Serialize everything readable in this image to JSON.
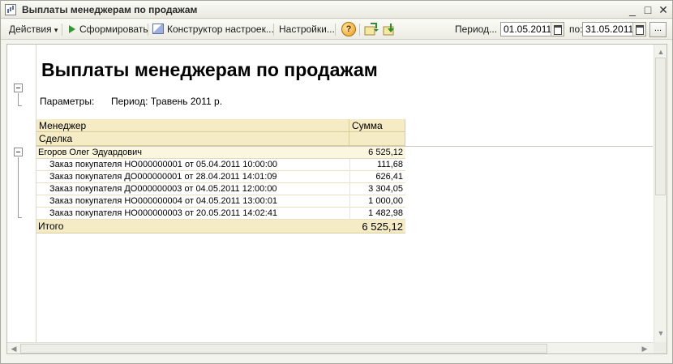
{
  "window": {
    "title": "Выплаты менеджерам по продажам",
    "minimize_glyph": "_",
    "maximize_glyph": "□",
    "close_glyph": "✕"
  },
  "toolbar": {
    "actions_label": "Действия",
    "actions_arrow": "▾",
    "generate_label": "Сформировать",
    "constructor_label": "Конструктор настроек...",
    "settings_label": "Настройки...",
    "help_glyph": "?",
    "period_label": "Период...",
    "period_from": "01.05.2011",
    "to_label": "по:",
    "period_to": "31.05.2011",
    "more_label": "..."
  },
  "report": {
    "title": "Выплаты менеджерам по продажам",
    "params_label": "Параметры:",
    "params_value": "Период: Травень 2011 р.",
    "columns": {
      "manager": "Менеджер",
      "deal": "Сделка",
      "sum": "Сумма"
    },
    "group": {
      "name": "Егоров Олег Эдуардович",
      "sum": "6 525,12"
    },
    "rows": [
      {
        "deal": "Заказ покупателя НО000000001 от 05.04.2011 10:00:00",
        "sum": "111,68"
      },
      {
        "deal": "Заказ покупателя ДО000000001 от 28.04.2011 14:01:09",
        "sum": "626,41"
      },
      {
        "deal": "Заказ покупателя ДО000000003 от 04.05.2011 12:00:00",
        "sum": "3 304,05"
      },
      {
        "deal": "Заказ покупателя НО000000004 от 04.05.2011 13:00:01",
        "sum": "1 000,00"
      },
      {
        "deal": "Заказ покупателя НО000000003 от 20.05.2011 14:02:41",
        "sum": "1 482,98"
      }
    ],
    "total": {
      "label": "Итого",
      "sum": "6 525,12"
    }
  },
  "icons": [
    "app-icon",
    "play-icon",
    "constructor-icon",
    "help-icon",
    "save-variant-icon",
    "load-variant-icon",
    "calendar-icon"
  ]
}
